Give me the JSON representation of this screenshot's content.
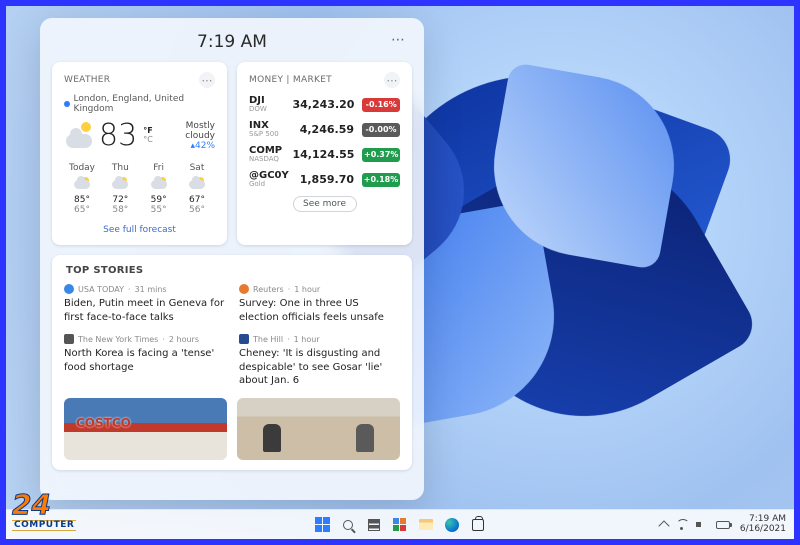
{
  "widgets": {
    "time": "7:19 AM",
    "weather": {
      "title": "WEATHER",
      "location": "London, England, United Kingdom",
      "temp": "83",
      "units_active": "°F",
      "units_inactive": "°C",
      "condition": "Mostly cloudy",
      "humidity": "▴42%",
      "link": "See full forecast",
      "forecast": [
        {
          "day": "Today",
          "hi": "85°",
          "lo": "65°"
        },
        {
          "day": "Thu",
          "hi": "72°",
          "lo": "58°"
        },
        {
          "day": "Fri",
          "hi": "59°",
          "lo": "55°"
        },
        {
          "day": "Sat",
          "hi": "67°",
          "lo": "56°"
        }
      ]
    },
    "money": {
      "title": "MONEY | MARKET",
      "link": "See more",
      "rows": [
        {
          "sym": "DJI",
          "name": "DOW",
          "value": "34,243.20",
          "change": "-0.16%",
          "dir": "neg"
        },
        {
          "sym": "INX",
          "name": "S&P 500",
          "value": "4,246.59",
          "change": "-0.00%",
          "dir": "neu"
        },
        {
          "sym": "COMP",
          "name": "NASDAQ",
          "value": "14,124.55",
          "change": "+0.37%",
          "dir": "pos"
        },
        {
          "sym": "@GC0Y",
          "name": "Gold",
          "value": "1,859.70",
          "change": "+0.18%",
          "dir": "pos"
        }
      ]
    },
    "stories": {
      "title": "TOP STORIES",
      "items": [
        {
          "source": "USA TODAY",
          "age": "31 mins",
          "headline": "Biden, Putin meet in Geneva for first face-to-face talks",
          "dot": ""
        },
        {
          "source": "Reuters",
          "age": "1 hour",
          "headline": "Survey: One in three US election officials feels unsafe",
          "dot": "r"
        },
        {
          "source": "The New York Times",
          "age": "2 hours",
          "headline": "North Korea is facing a 'tense' food shortage",
          "dot": "n"
        },
        {
          "source": "The Hill",
          "age": "1 hour",
          "headline": "Cheney: 'It is disgusting and despicable' to see Gosar 'lie' about Jan. 6",
          "dot": "h"
        }
      ]
    }
  },
  "taskbar": {
    "time": "7:19 AM",
    "date": "6/16/2021"
  },
  "watermark": {
    "big": "24",
    "label": "COMPUTER"
  }
}
